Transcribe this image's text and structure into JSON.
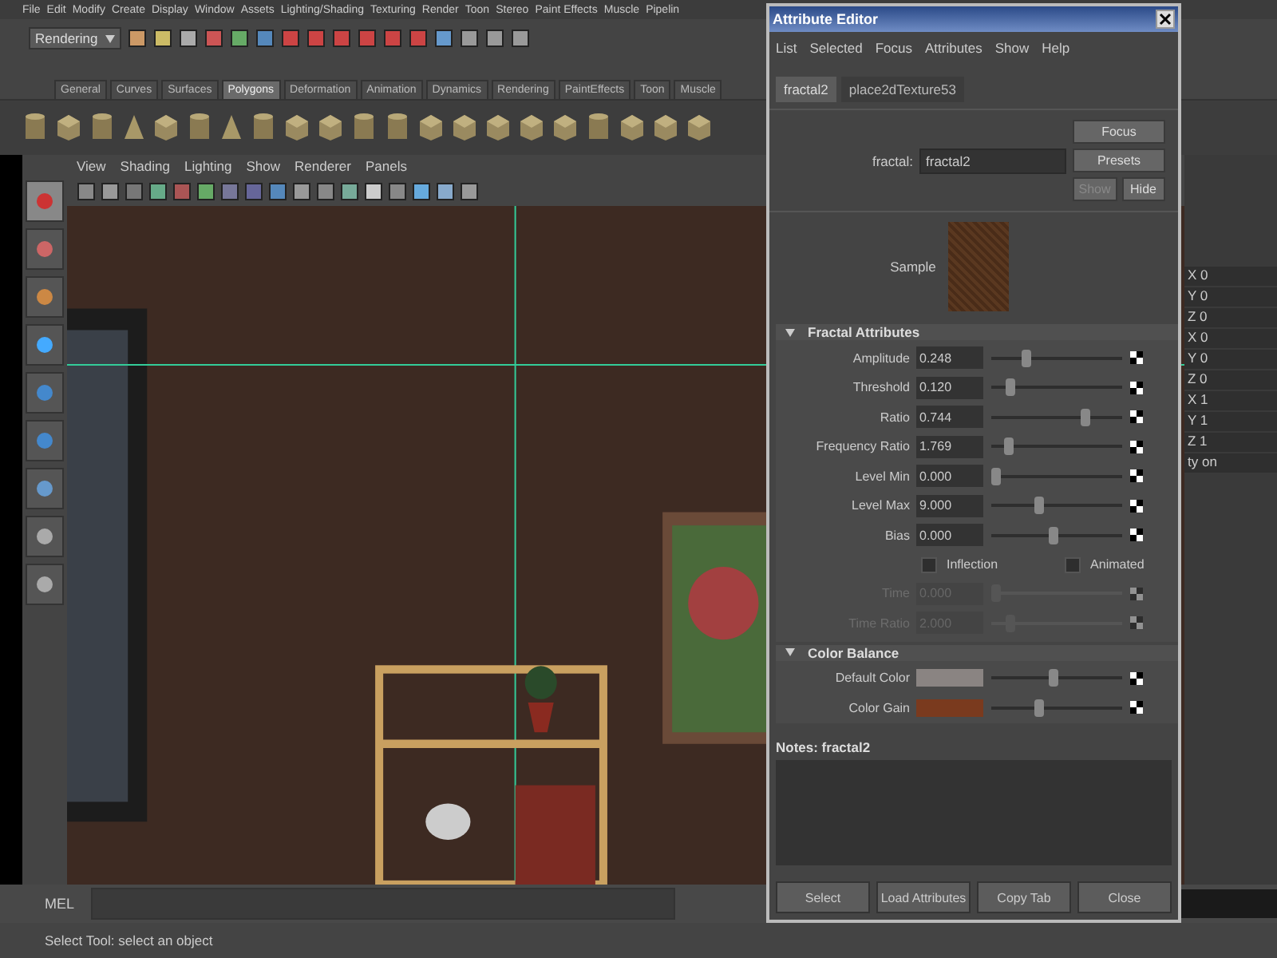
{
  "menu_bar": [
    "File",
    "Edit",
    "Modify",
    "Create",
    "Display",
    "Window",
    "Assets",
    "Lighting/Shading",
    "Texturing",
    "Render",
    "Toon",
    "Stereo",
    "Paint Effects",
    "Muscle",
    "Pipelin"
  ],
  "status_line": {
    "menu_set": "Rendering"
  },
  "shelf_tabs": [
    {
      "label": "General",
      "selected": false
    },
    {
      "label": "Curves",
      "selected": false
    },
    {
      "label": "Surfaces",
      "selected": false
    },
    {
      "label": "Polygons",
      "selected": true
    },
    {
      "label": "Deformation",
      "selected": false
    },
    {
      "label": "Animation",
      "selected": false
    },
    {
      "label": "Dynamics",
      "selected": false
    },
    {
      "label": "Rendering",
      "selected": false
    },
    {
      "label": "PaintEffects",
      "selected": false
    },
    {
      "label": "Toon",
      "selected": false
    },
    {
      "label": "Muscle",
      "selected": false
    }
  ],
  "viewport": {
    "menu": [
      "View",
      "Shading",
      "Lighting",
      "Show",
      "Renderer",
      "Panels"
    ]
  },
  "channel_box": {
    "values": [
      "X 0",
      "Y 0",
      "Z 0",
      "X 0",
      "Y 0",
      "Z 0",
      "X 1",
      "Y 1",
      "Z 1",
      "ty on"
    ]
  },
  "command_line": {
    "label": "MEL"
  },
  "help_line": "Select Tool: select an object",
  "attribute_editor": {
    "title": "Attribute Editor",
    "menu": [
      "List",
      "Selected",
      "Focus",
      "Attributes",
      "Show",
      "Help"
    ],
    "tabs": [
      {
        "label": "fractal2",
        "selected": true
      },
      {
        "label": "place2dTexture53",
        "selected": false
      }
    ],
    "node_label": "fractal:",
    "node_name": "fractal2",
    "side_buttons": [
      {
        "label": "Focus",
        "disabled": false
      },
      {
        "label": "Presets",
        "disabled": false
      },
      {
        "label": "Show",
        "disabled": true
      },
      {
        "label": "Hide",
        "disabled": false
      }
    ],
    "sample_label": "Sample",
    "sections": [
      {
        "title": "Fractal Attributes",
        "expanded": true,
        "rows": [
          {
            "kind": "slider",
            "label": "Amplitude",
            "value": "0.248",
            "level": 0.25,
            "disabled": false
          },
          {
            "kind": "slider",
            "label": "Threshold",
            "value": "0.120",
            "level": 0.12,
            "disabled": false
          },
          {
            "kind": "slider",
            "label": "Ratio",
            "value": "0.744",
            "level": 0.74,
            "disabled": false
          },
          {
            "kind": "slider",
            "label": "Frequency Ratio",
            "value": "1.769",
            "level": 0.1,
            "disabled": false
          },
          {
            "kind": "slider",
            "label": "Level Min",
            "value": "0.000",
            "level": 0.0,
            "disabled": false
          },
          {
            "kind": "slider",
            "label": "Level Max",
            "value": "9.000",
            "level": 0.36,
            "disabled": false
          },
          {
            "kind": "slider",
            "label": "Bias",
            "value": "0.000",
            "level": 0.48,
            "disabled": false
          },
          {
            "kind": "checkboxes",
            "items": [
              {
                "label": "Inflection",
                "checked": false
              },
              {
                "label": "Animated",
                "checked": false
              }
            ]
          },
          {
            "kind": "slider",
            "label": "Time",
            "value": "0.000",
            "level": 0.0,
            "disabled": true
          },
          {
            "kind": "slider",
            "label": "Time Ratio",
            "value": "2.000",
            "level": 0.12,
            "disabled": true
          }
        ]
      },
      {
        "title": "Color Balance",
        "expanded": true,
        "rows": [
          {
            "kind": "color",
            "label": "Default Color",
            "color": "#8a8482",
            "level": 0.48
          },
          {
            "kind": "color",
            "label": "Color Gain",
            "color": "#7a3a1e",
            "level": 0.36
          }
        ]
      }
    ],
    "notes_label": "Notes: fractal2",
    "footer_buttons": [
      "Select",
      "Load Attributes",
      "Copy Tab",
      "Close"
    ]
  }
}
